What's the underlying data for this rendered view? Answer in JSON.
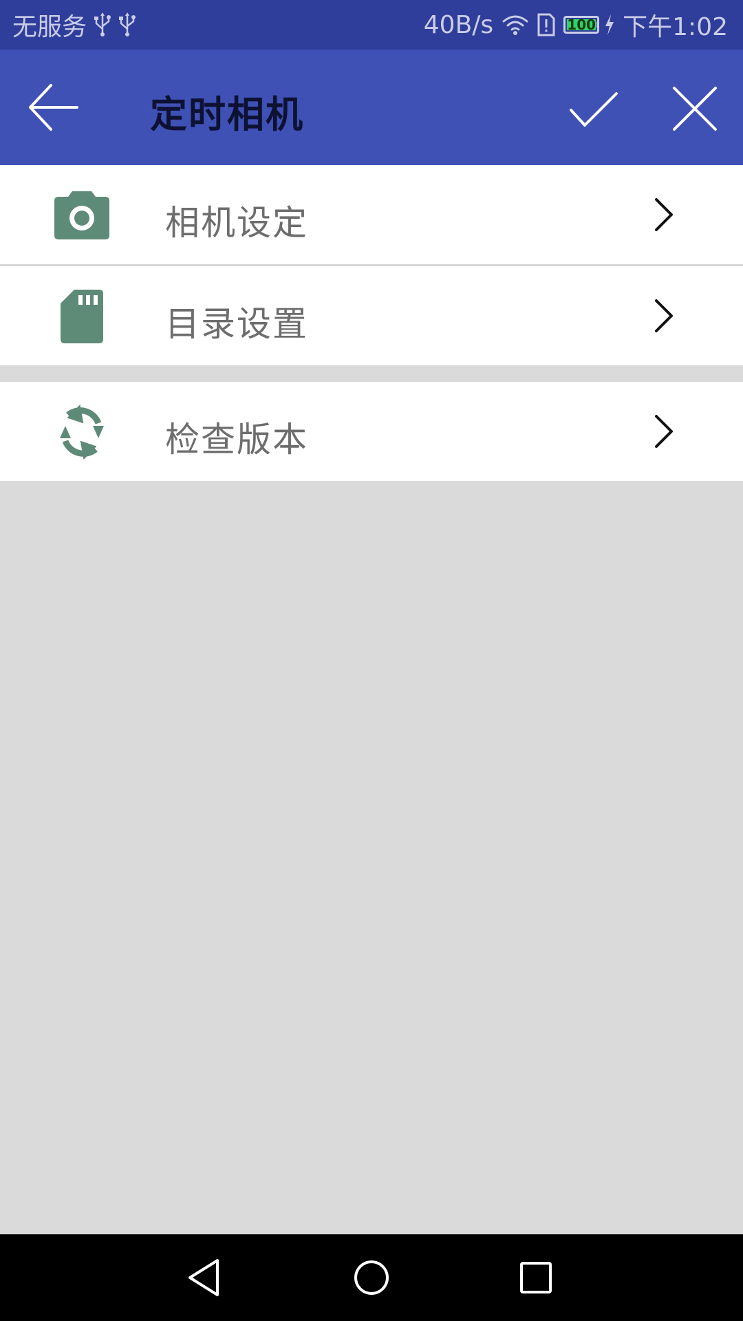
{
  "status_bar": {
    "carrier": "无服务",
    "net_speed": "40B/s",
    "battery_level": "100",
    "time": "下午1:02",
    "icons": [
      "usb-icon",
      "usb-icon",
      "wifi-icon",
      "sim-alert-icon",
      "battery-icon",
      "charging-icon"
    ]
  },
  "app_bar": {
    "title": "定时相机",
    "back_icon": "arrow-left-icon",
    "confirm_icon": "check-icon",
    "close_icon": "close-icon"
  },
  "settings": {
    "items": [
      {
        "label": "相机设定",
        "icon": "camera-icon"
      },
      {
        "label": "目录设置",
        "icon": "sd-card-icon"
      },
      {
        "label": "检查版本",
        "icon": "sync-icon"
      }
    ]
  },
  "colors": {
    "status_bar": "#2f3d9b",
    "app_bar": "#3f51b5",
    "icon_tint": "#5e8a78",
    "background": "#dadada",
    "row_bg": "#ffffff",
    "label_text": "#6d6d6d"
  },
  "nav_bar": {
    "buttons": [
      "back-triangle-icon",
      "home-circle-icon",
      "recents-square-icon"
    ]
  }
}
